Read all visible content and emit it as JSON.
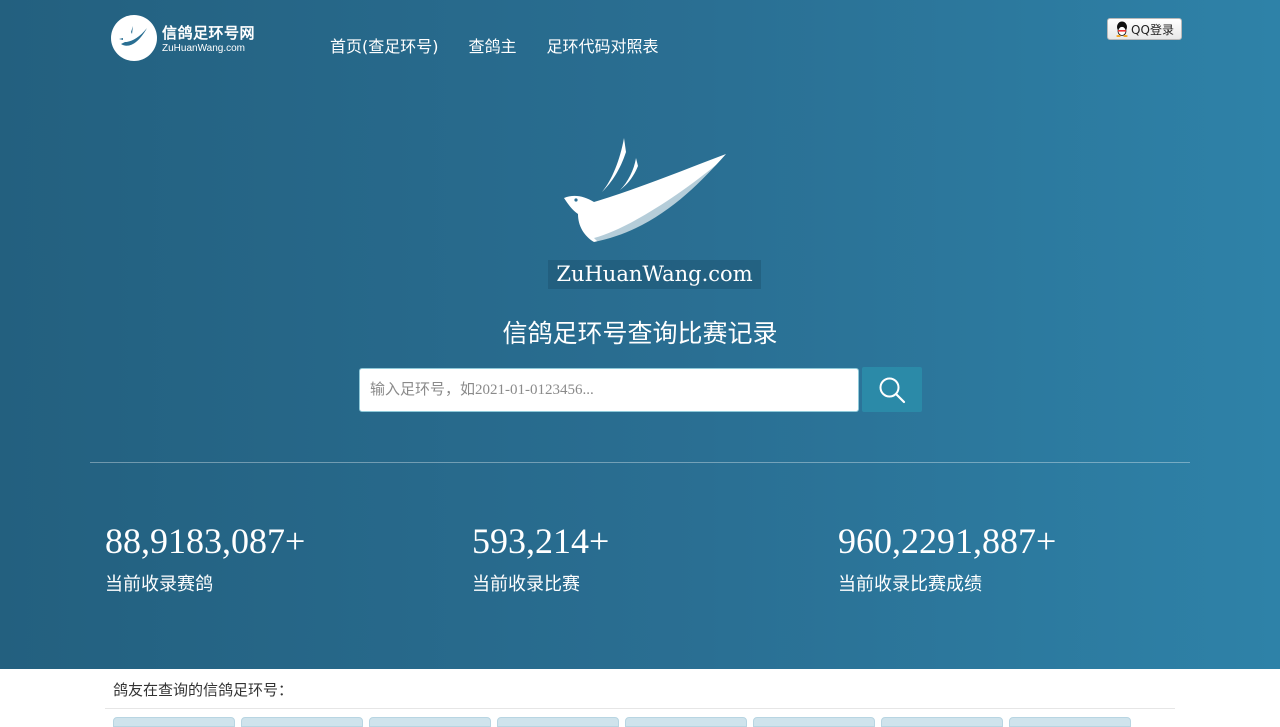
{
  "brand": {
    "logo_title": "信鸽足环号网",
    "logo_subtitle": "ZuHuanWang.com"
  },
  "nav": {
    "items": [
      {
        "label": "首页(查足环号)"
      },
      {
        "label": "查鸽主"
      },
      {
        "label": "足环代码对照表"
      }
    ]
  },
  "login": {
    "qq_label": "QQ登录"
  },
  "hero": {
    "domain_text": "ZuHuanWang.com",
    "headline": "信鸽足环号查询比赛记录"
  },
  "search": {
    "placeholder": "输入足环号，如2021-01-0123456..."
  },
  "stats": [
    {
      "value": "88,9183,087+",
      "label": "当前收录赛鸽"
    },
    {
      "value": "593,214+",
      "label": "当前收录比赛"
    },
    {
      "value": "960,2291,887+",
      "label": "当前收录比赛成绩"
    }
  ],
  "recent": {
    "title": "鸽友在查询的信鸽足环号："
  },
  "colors": {
    "hero_start": "#23607f",
    "hero_end": "#2e82a8",
    "search_button": "#2b8aa8"
  }
}
